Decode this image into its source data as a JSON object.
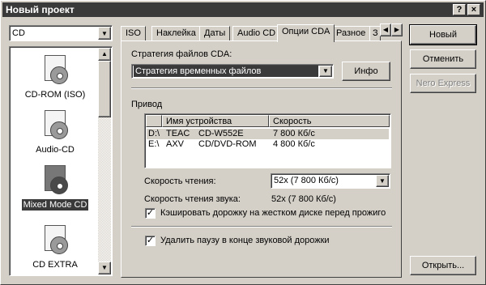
{
  "window": {
    "title": "Новый проект",
    "help_btn": "?",
    "close_btn": "×"
  },
  "left": {
    "media_select": "CD",
    "items": [
      {
        "label": "CD-ROM (ISO)",
        "icon": "cd-rom-iso-icon",
        "selected": false
      },
      {
        "label": "Audio-CD",
        "icon": "audio-cd-icon",
        "selected": false
      },
      {
        "label": "Mixed Mode CD",
        "icon": "mixed-mode-cd-icon",
        "selected": true
      },
      {
        "label": "CD EXTRA",
        "icon": "cd-extra-icon",
        "selected": false
      }
    ]
  },
  "tabs": [
    {
      "label": "ISO",
      "active": false
    },
    {
      "label": "Наклейка",
      "active": false
    },
    {
      "label": "Даты",
      "active": false
    },
    {
      "label": "Audio CD",
      "active": false
    },
    {
      "label": "Опции CDA",
      "active": true
    },
    {
      "label": "Разное",
      "active": false
    },
    {
      "label": "З",
      "active": false
    }
  ],
  "cda_options": {
    "strategy_label": "Стратегия файлов CDA:",
    "strategy_value": "Стратегия временных файлов",
    "info_button": "Инфо",
    "drive_label": "Привод",
    "columns": [
      "Имя устройства",
      "Скорость"
    ],
    "drives": [
      {
        "letter": "D:\\",
        "vendor": "TEAC",
        "model": "CD-W552E",
        "speed": "7 800 Кб/с"
      },
      {
        "letter": "E:\\",
        "vendor": "AXV",
        "model": "CD/DVD-ROM",
        "speed": "4 800 Кб/с"
      }
    ],
    "read_speed_label": "Скорость чтения:",
    "read_speed_value": "52x (7 800 Кб/с)",
    "audio_speed_label": "Скорость чтения звука:",
    "audio_speed_value": "52x (7 800 Кб/с)",
    "cache_checkbox": "Кэшировать дорожку на жестком диске перед прожиго",
    "cache_checked": true,
    "pause_checkbox": "Удалить паузу в конце звуковой дорожки",
    "pause_checked": true
  },
  "buttons": {
    "new": "Новый",
    "cancel": "Отменить",
    "nero_express": "Nero Express",
    "open": "Открыть..."
  }
}
